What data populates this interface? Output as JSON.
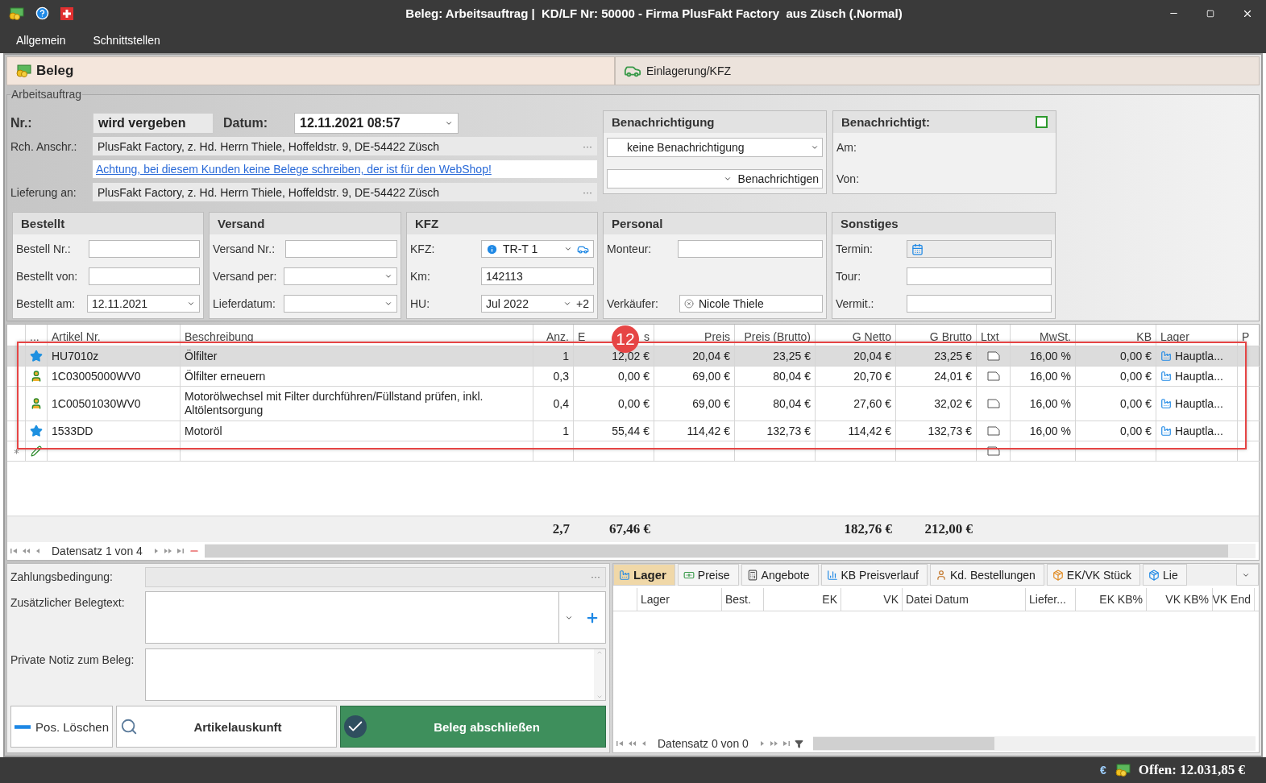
{
  "window": {
    "title": "Beleg: Arbeitsauftrag |  KD/LF Nr: 50000 - Firma PlusFakt Factory  aus Züsch (.Normal)"
  },
  "menu": [
    "Allgemein",
    "Schnittstellen"
  ],
  "tabs": [
    {
      "label": "Beleg",
      "selected": true
    },
    {
      "label": "Einlagerung/KFZ",
      "selected": false
    }
  ],
  "order": {
    "group": "Arbeitsauftrag",
    "nr_label": "Nr.:",
    "nr_value": "wird vergeben",
    "date_label": "Datum:",
    "date_value": "12.11.2021 08:57",
    "billing_label": "Rch. Anschr.:",
    "billing_value": "PlusFakt Factory, z. Hd. Herrn Thiele, Hoffeldstr. 9, DE-54422 Züsch",
    "warning": "Achtung, bei diesem Kunden keine Belege schreiben, der ist für den WebShop!",
    "delivery_label": "Lieferung an:",
    "delivery_value": "PlusFakt Factory, z. Hd. Herrn Thiele, Hoffeldstr. 9, DE-54422 Züsch",
    "ellipsis": "···"
  },
  "notification": {
    "title": "Benachrichtigung",
    "mode": "keine Benachrichtigung",
    "action": "Benachrichtigen"
  },
  "notified": {
    "title": "Benachrichtigt:",
    "checked": false,
    "labels": [
      "Am:",
      "Von:"
    ]
  },
  "groups": [
    {
      "title": "Bestellt",
      "fields": [
        {
          "label": "Bestell Nr.:",
          "kind": "text"
        },
        {
          "label": "Bestellt von:",
          "kind": "text"
        },
        {
          "label": "Bestellt am:",
          "kind": "dropdown",
          "value": "12.11.2021"
        }
      ]
    },
    {
      "title": "Versand",
      "fields": [
        {
          "label": "Versand Nr.:",
          "kind": "text"
        },
        {
          "label": "Versand per:",
          "kind": "dropdown"
        },
        {
          "label": "Lieferdatum:",
          "kind": "dropdown"
        }
      ]
    },
    {
      "title": "KFZ",
      "fields": [
        {
          "label": "KFZ:",
          "kind": "vehicle",
          "value": "TR-T 1"
        },
        {
          "label": "Km:",
          "kind": "text",
          "value": "142113"
        },
        {
          "label": "HU:",
          "kind": "hu",
          "value": "Jul 2022",
          "extra": "+2"
        }
      ]
    },
    {
      "title": "Personal",
      "fields": [
        {
          "label": "Monteur:",
          "kind": "text"
        },
        {
          "label": "Verkäufer:",
          "kind": "person",
          "value": "Nicole Thiele"
        }
      ]
    },
    {
      "title": "Sonstiges",
      "fields": [
        {
          "label": "Termin:",
          "kind": "calendar"
        },
        {
          "label": "Tour:",
          "kind": "text"
        },
        {
          "label": "Vermit.:",
          "kind": "text"
        }
      ]
    }
  ],
  "table": {
    "columns": [
      {
        "label": "...",
        "kind": "icon"
      },
      {
        "label": "Artikel Nr.",
        "kind": "text"
      },
      {
        "label": "Beschreibung",
        "kind": "text"
      },
      {
        "label": "Anz.",
        "kind": "number",
        "total": "2,7"
      },
      {
        "label": "E",
        "label_tail": "s",
        "kind": "number",
        "total": "67,46 €"
      },
      {
        "label": "Preis",
        "kind": "number"
      },
      {
        "label": "Preis (Brutto)",
        "kind": "number"
      },
      {
        "label": "G Netto",
        "kind": "number",
        "total": "182,76 €"
      },
      {
        "label": "G Brutto",
        "kind": "number",
        "total": "212,00 €"
      },
      {
        "label": "Ltxt",
        "kind": "note"
      },
      {
        "label": "MwSt.",
        "kind": "number"
      },
      {
        "label": "KB",
        "kind": "number"
      },
      {
        "label": "Lager",
        "kind": "warehouse"
      },
      {
        "label": "P",
        "kind": "blank"
      }
    ],
    "rows": [
      {
        "kind": "article",
        "selected": true,
        "values": [
          "HU7010z",
          "Ölfilter",
          "1",
          "12,02 €",
          "20,04 €",
          "23,25 €",
          "20,04 €",
          "23,25 €",
          "16,00 %",
          "0,00 €",
          "Hauptla..."
        ]
      },
      {
        "kind": "service",
        "selected": false,
        "values": [
          "1C03005000WV0",
          "Ölfilter erneuern",
          "0,3",
          "0,00 €",
          "69,00 €",
          "80,04 €",
          "20,70 €",
          "24,01 €",
          "16,00 %",
          "0,00 €",
          "Hauptla..."
        ]
      },
      {
        "kind": "service",
        "selected": false,
        "values": [
          "1C00501030WV0",
          "Motorölwechsel mit Filter durchführen/Füllstand prüfen, inkl. Altölentsorgung",
          "0,4",
          "0,00 €",
          "69,00 €",
          "80,04 €",
          "27,60 €",
          "32,02 €",
          "16,00 %",
          "0,00 €",
          "Hauptla..."
        ]
      },
      {
        "kind": "article",
        "selected": false,
        "values": [
          "1533DD",
          "Motoröl",
          "1",
          "55,44 €",
          "114,42 €",
          "132,73 €",
          "114,42 €",
          "132,73 €",
          "16,00 %",
          "0,00 €",
          "Hauptla..."
        ]
      }
    ],
    "navigator": "Datensatz 1 von 4",
    "annotation": "12"
  },
  "footer": {
    "payment_label": "Zahlungsbedingung:",
    "payment_ellipsis": "···",
    "text_label": "Zusätzlicher Belegtext:",
    "note_label": "Private Notiz zum Beleg:",
    "buttons": [
      {
        "label": "Pos. Löschen",
        "kind": "delete"
      },
      {
        "label": "Artikelauskunft",
        "kind": "info"
      },
      {
        "label": "Beleg abschließen",
        "kind": "finish"
      }
    ]
  },
  "side": {
    "tabs": [
      {
        "label": "Lager",
        "selected": true
      },
      {
        "label": "Preise",
        "selected": false
      },
      {
        "label": "Angebote",
        "selected": false
      },
      {
        "label": "KB Preisverlauf",
        "selected": false
      },
      {
        "label": "Kd. Bestellungen",
        "selected": false
      },
      {
        "label": "EK/VK Stück",
        "selected": false
      },
      {
        "label": "Lie",
        "selected": false
      }
    ],
    "columns": [
      "Lager",
      "Best.",
      "EK",
      "VK",
      "Datei Datum",
      "Liefer...",
      "EK KB%",
      "VK KB%",
      "VK End"
    ],
    "navigator": "Datensatz 0 von 0"
  },
  "status_bar": {
    "currency": "€",
    "open": "Offen: 12.031,85 €"
  }
}
